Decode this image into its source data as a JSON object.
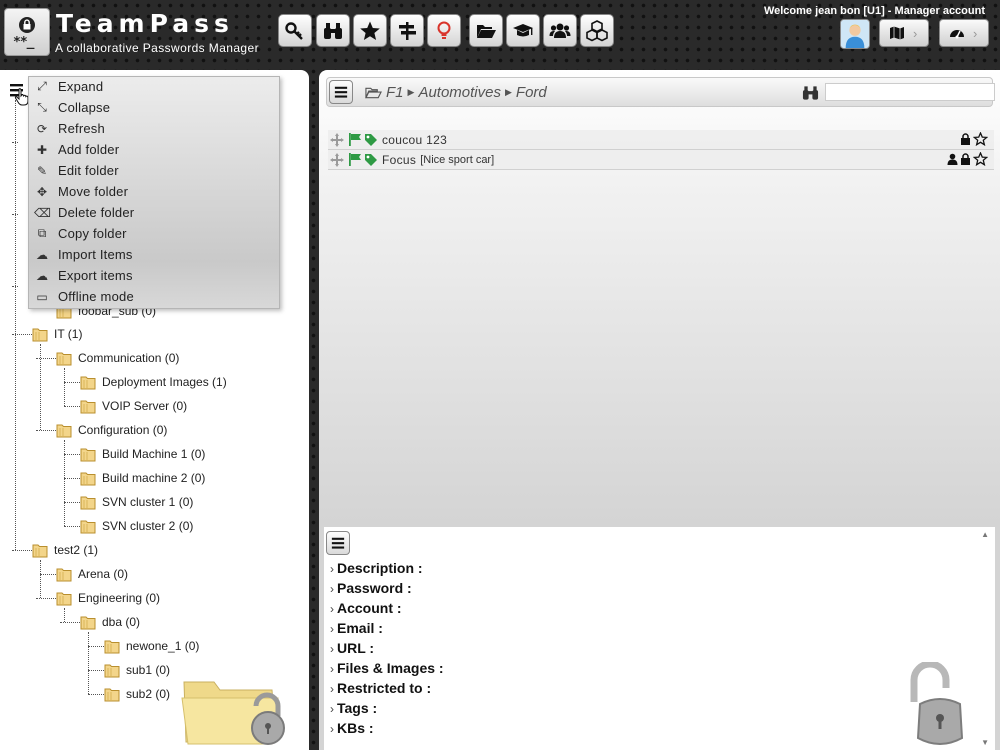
{
  "app": {
    "title": "TeamPass",
    "subtitle": "A collaborative Passwords Manager",
    "welcome": "Welcome jean bon [U1] - Manager account"
  },
  "colors": {
    "folder": "#f3d58a",
    "flag": "#2e9a44",
    "bulb": "#d9342b"
  },
  "toolbar": [
    {
      "name": "key-icon"
    },
    {
      "name": "binoculars-icon"
    },
    {
      "name": "star-icon"
    },
    {
      "name": "signpost-icon"
    },
    {
      "name": "lightbulb-icon"
    },
    {
      "name": "folder-open-icon"
    },
    {
      "name": "graduation-cap-icon"
    },
    {
      "name": "users-icon"
    },
    {
      "name": "cubes-icon"
    }
  ],
  "context_menu": {
    "items": [
      {
        "label": "Expand",
        "icon": "expand-icon"
      },
      {
        "label": "Collapse",
        "icon": "collapse-icon"
      },
      {
        "label": "Refresh",
        "icon": "refresh-icon"
      },
      {
        "label": "Add folder",
        "icon": "plus-icon"
      },
      {
        "label": "Edit folder",
        "icon": "pencil-icon"
      },
      {
        "label": "Move folder",
        "icon": "move-icon"
      },
      {
        "label": "Delete folder",
        "icon": "eraser-icon"
      },
      {
        "label": "Copy folder",
        "icon": "copy-icon"
      },
      {
        "label": "Import Items",
        "icon": "cloud-upload-icon"
      },
      {
        "label": "Export items",
        "icon": "cloud-download-icon"
      },
      {
        "label": "Offline mode",
        "icon": "laptop-icon"
      }
    ]
  },
  "tree": {
    "partial_node": "foobar_sub (0)",
    "nodes": [
      {
        "label": "IT (1)",
        "depth": 0
      },
      {
        "label": "Communication (0)",
        "depth": 1
      },
      {
        "label": "Deployment Images (1)",
        "depth": 2
      },
      {
        "label": "VOIP Server (0)",
        "depth": 2
      },
      {
        "label": "Configuration (0)",
        "depth": 1
      },
      {
        "label": "Build Machine 1 (0)",
        "depth": 2
      },
      {
        "label": "Build machine 2 (0)",
        "depth": 2
      },
      {
        "label": "SVN cluster 1 (0)",
        "depth": 2
      },
      {
        "label": "SVN cluster 2 (0)",
        "depth": 2
      },
      {
        "label": "test2 (1)",
        "depth": 0
      },
      {
        "label": "Arena (0)",
        "depth": 1
      },
      {
        "label": "Engineering (0)",
        "depth": 1
      },
      {
        "label": "dba (0)",
        "depth": 2
      },
      {
        "label": "newone_1 (0)",
        "depth": 3
      },
      {
        "label": "sub1 (0)",
        "depth": 3
      },
      {
        "label": "sub2 (0)",
        "depth": 3
      }
    ]
  },
  "breadcrumb": [
    "F1",
    "Automotives",
    "Ford"
  ],
  "search": {
    "value": "",
    "placeholder": ""
  },
  "items": [
    {
      "label": "coucou 123",
      "description": "",
      "restricted": false
    },
    {
      "label": "Focus",
      "description": "[Nice sport car]",
      "restricted": true
    }
  ],
  "details": {
    "fields": [
      "Description :",
      "Password :",
      "Account :",
      "Email :",
      "URL :",
      "Files & Images :",
      "Restricted to :",
      "Tags :",
      "KBs :"
    ]
  }
}
